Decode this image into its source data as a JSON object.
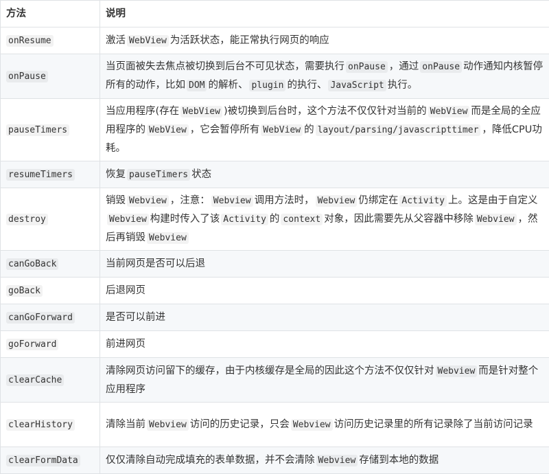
{
  "table": {
    "headers": [
      "方法",
      "说明"
    ],
    "rows": [
      {
        "method": "onResume",
        "parts": [
          [
            "t",
            "激活"
          ],
          [
            "c",
            "WebView"
          ],
          [
            "t",
            "为活跃状态，能正常执行网页的响应"
          ]
        ]
      },
      {
        "method": "onPause",
        "parts": [
          [
            "t",
            "当页面被失去焦点被切换到后台不可见状态，需要执行"
          ],
          [
            "c",
            "onPause"
          ],
          [
            "t",
            "，通过"
          ],
          [
            "c",
            "onPause"
          ],
          [
            "t",
            "动作通知内核暂停所有的动作，比如"
          ],
          [
            "c",
            "DOM"
          ],
          [
            "t",
            "的解析、"
          ],
          [
            "c",
            "plugin"
          ],
          [
            "t",
            "的执行、"
          ],
          [
            "c",
            "JavaScript"
          ],
          [
            "t",
            "执行。"
          ]
        ]
      },
      {
        "method": "pauseTimers",
        "parts": [
          [
            "t",
            "当应用程序(存在"
          ],
          [
            "c",
            "WebView"
          ],
          [
            "t",
            ")被切换到后台时，这个方法不仅仅针对当前的"
          ],
          [
            "c",
            "WebView"
          ],
          [
            "t",
            "而是全局的全应用程序的"
          ],
          [
            "c",
            "WebView"
          ],
          [
            "t",
            "，它会暂停所有"
          ],
          [
            "c",
            "WebView"
          ],
          [
            "t",
            "的"
          ],
          [
            "c",
            "layout/parsing/javascripttimer"
          ],
          [
            "t",
            "，降低CPU功耗。"
          ]
        ]
      },
      {
        "method": "resumeTimers",
        "parts": [
          [
            "t",
            "恢复"
          ],
          [
            "c",
            "pauseTimers"
          ],
          [
            "t",
            "状态"
          ]
        ]
      },
      {
        "method": "destroy",
        "parts": [
          [
            "t",
            "销毁"
          ],
          [
            "c",
            "Webview"
          ],
          [
            "t",
            "，注意："
          ],
          [
            "c",
            "Webview"
          ],
          [
            "t",
            "调用方法时，"
          ],
          [
            "c",
            "Webview"
          ],
          [
            "t",
            "仍绑定在"
          ],
          [
            "c",
            "Activity"
          ],
          [
            "t",
            "上。这是由于自定义"
          ],
          [
            "c",
            "Webview"
          ],
          [
            "t",
            "构建时传入了该"
          ],
          [
            "c",
            "Activity"
          ],
          [
            "t",
            "的"
          ],
          [
            "c",
            "context"
          ],
          [
            "t",
            "对象，因此需要先从父容器中移除"
          ],
          [
            "c",
            "Webview"
          ],
          [
            "t",
            "，然后再销毁"
          ],
          [
            "c",
            "Webview"
          ]
        ]
      },
      {
        "method": "canGoBack",
        "parts": [
          [
            "t",
            "当前网页是否可以后退"
          ]
        ]
      },
      {
        "method": "goBack",
        "parts": [
          [
            "t",
            "后退网页"
          ]
        ]
      },
      {
        "method": "canGoForward",
        "parts": [
          [
            "t",
            "是否可以前进"
          ]
        ]
      },
      {
        "method": "goForward",
        "parts": [
          [
            "t",
            "前进网页"
          ]
        ]
      },
      {
        "method": "clearCache",
        "parts": [
          [
            "t",
            "清除网页访问留下的缓存，由于内核缓存是全局的因此这个方法不仅仅针对"
          ],
          [
            "c",
            "Webview"
          ],
          [
            "t",
            "而是针对整个应用程序"
          ]
        ]
      },
      {
        "method": "clearHistory",
        "parts": [
          [
            "t",
            "清除当前"
          ],
          [
            "c",
            "Webview"
          ],
          [
            "t",
            "访问的历史记录，只会"
          ],
          [
            "c",
            "Webview"
          ],
          [
            "t",
            "访问历史记录里的所有记录除了当前访问记录"
          ]
        ]
      },
      {
        "method": "clearFormData",
        "parts": [
          [
            "t",
            "仅仅清除自动完成填充的表单数据，并不会清除"
          ],
          [
            "c",
            "Webview"
          ],
          [
            "t",
            "存储到本地的数据"
          ]
        ]
      }
    ]
  }
}
